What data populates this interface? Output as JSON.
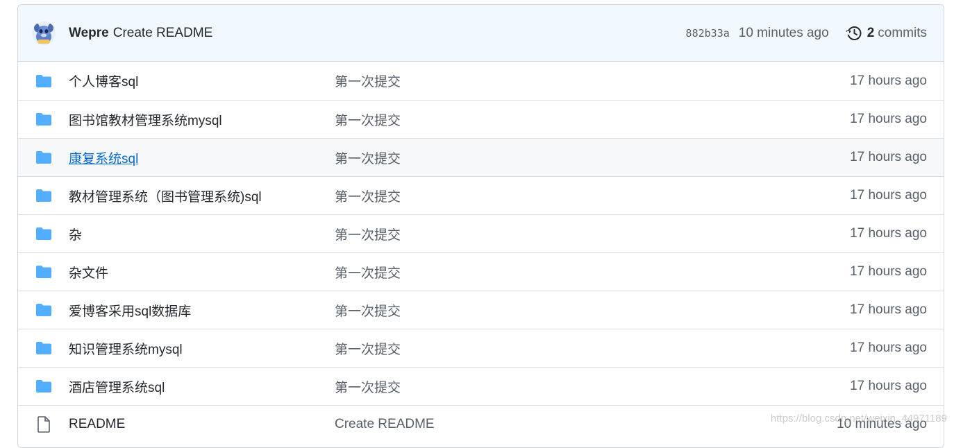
{
  "commit": {
    "author": "Wepre",
    "message": "Create README",
    "sha": "882b33a",
    "time": "10 minutes ago",
    "commits_count": "2",
    "commits_label": "commits",
    "history_icon": "history-icon",
    "avatar_icon": "avatar-icon"
  },
  "files": [
    {
      "type": "folder",
      "name": "个人博客sql",
      "message": "第一次提交",
      "age": "17 hours ago"
    },
    {
      "type": "folder",
      "name": "图书馆教材管理系统mysql",
      "message": "第一次提交",
      "age": "17 hours ago"
    },
    {
      "type": "folder",
      "name": "康复系统sql",
      "message": "第一次提交",
      "age": "17 hours ago"
    },
    {
      "type": "folder",
      "name": "教材管理系统（图书管理系统)sql",
      "message": "第一次提交",
      "age": "17 hours ago"
    },
    {
      "type": "folder",
      "name": "杂",
      "message": "第一次提交",
      "age": "17 hours ago"
    },
    {
      "type": "folder",
      "name": "杂文件",
      "message": "第一次提交",
      "age": "17 hours ago"
    },
    {
      "type": "folder",
      "name": "爱博客采用sql数据库",
      "message": "第一次提交",
      "age": "17 hours ago"
    },
    {
      "type": "folder",
      "name": "知识管理系统mysql",
      "message": "第一次提交",
      "age": "17 hours ago"
    },
    {
      "type": "folder",
      "name": "酒店管理系统sql",
      "message": "第一次提交",
      "age": "17 hours ago"
    },
    {
      "type": "file",
      "name": "README",
      "message": "Create README",
      "age": "10 minutes ago"
    }
  ],
  "watermark": "https://blog.csdn.net/weixin_44971189",
  "colors": {
    "folder": "#54aeff",
    "link": "#0969da",
    "header_bg": "#f1f8ff"
  }
}
